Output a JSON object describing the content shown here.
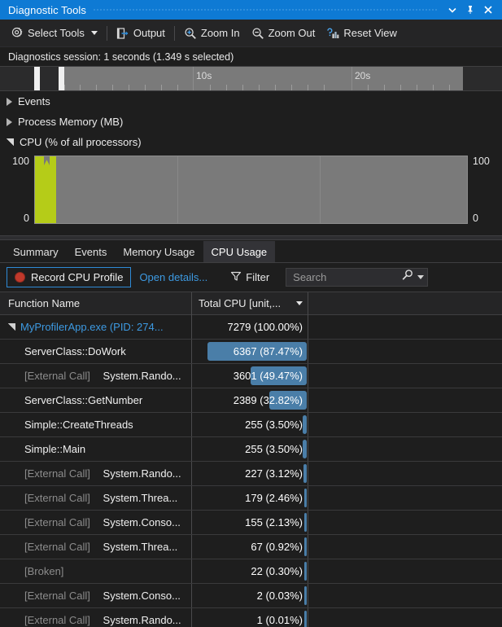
{
  "window": {
    "title": "Diagnostic Tools",
    "controls": [
      {
        "name": "window-dropdown-button",
        "icon": "chevron-down-icon"
      },
      {
        "name": "pin-button",
        "icon": "pin-icon"
      },
      {
        "name": "close-button",
        "icon": "close-icon"
      }
    ]
  },
  "toolbar": {
    "select_tools_label": "Select Tools",
    "output_label": "Output",
    "zoom_in_label": "Zoom In",
    "zoom_out_label": "Zoom Out",
    "reset_view_label": "Reset View"
  },
  "session": {
    "text": "Diagnostics session: 1 seconds (1.349 s selected)"
  },
  "ruler": {
    "labels": [
      {
        "text": "10s",
        "x": 239
      },
      {
        "text": "20s",
        "x": 434
      }
    ]
  },
  "sections": [
    {
      "label": "Events",
      "expanded": false
    },
    {
      "label": "Process Memory (MB)",
      "expanded": false
    },
    {
      "label": "CPU (% of all processors)",
      "expanded": true
    }
  ],
  "cpu_chart": {
    "axis_max": "100",
    "axis_min": "0"
  },
  "chart_data": {
    "type": "area",
    "title": "CPU (% of all processors)",
    "ylabel": "",
    "xlabel": "",
    "ylim": [
      0,
      100
    ],
    "axis_labels_left": [
      "100",
      "0"
    ],
    "axis_labels_right": [
      "100",
      "0"
    ],
    "grid": true,
    "series": [
      {
        "name": "CPU",
        "color": "#b5cc18",
        "x": [
          0.0,
          0.3,
          0.55,
          0.8,
          1.05,
          1.35
        ],
        "values": [
          100,
          100,
          82,
          100,
          100,
          0
        ]
      }
    ],
    "note": "Activity only in the first ~1.35 s of the 30 s timeline; remainder is empty."
  },
  "tabs": [
    {
      "label": "Summary",
      "active": false
    },
    {
      "label": "Events",
      "active": false
    },
    {
      "label": "Memory Usage",
      "active": false
    },
    {
      "label": "CPU Usage",
      "active": true
    }
  ],
  "actions": {
    "record_label": "Record CPU Profile",
    "open_details_label": "Open details...",
    "filter_label": "Filter",
    "search_placeholder": "Search"
  },
  "table": {
    "columns": [
      {
        "label": "Function Name"
      },
      {
        "label": "Total CPU [unit,..."
      }
    ],
    "rows": [
      {
        "name": "MyProfilerApp.exe (PID: 274...",
        "prefix": "",
        "style": "root",
        "expander": true,
        "cpu": "7279 (100.00%)",
        "pct": 100.0
      },
      {
        "name": "ServerClass::DoWork",
        "prefix": "",
        "style": "normal",
        "expander": false,
        "cpu": "6367 (87.47%)",
        "pct": 87.47
      },
      {
        "name": "System.Rando...",
        "prefix": "[External Call]",
        "style": "normal",
        "expander": false,
        "cpu": "3601 (49.47%)",
        "pct": 49.47
      },
      {
        "name": "ServerClass::GetNumber",
        "prefix": "",
        "style": "normal",
        "expander": false,
        "cpu": "2389 (32.82%)",
        "pct": 32.82
      },
      {
        "name": "Simple::CreateThreads",
        "prefix": "",
        "style": "normal",
        "expander": false,
        "cpu": "255 (3.50%)",
        "pct": 3.5
      },
      {
        "name": "Simple::Main",
        "prefix": "",
        "style": "normal",
        "expander": false,
        "cpu": "255 (3.50%)",
        "pct": 3.5
      },
      {
        "name": "System.Rando...",
        "prefix": "[External Call]",
        "style": "normal",
        "expander": false,
        "cpu": "227 (3.12%)",
        "pct": 3.12
      },
      {
        "name": "System.Threa...",
        "prefix": "[External Call]",
        "style": "normal",
        "expander": false,
        "cpu": "179 (2.46%)",
        "pct": 2.46
      },
      {
        "name": "System.Conso...",
        "prefix": "[External Call]",
        "style": "normal",
        "expander": false,
        "cpu": "155 (2.13%)",
        "pct": 2.13
      },
      {
        "name": "System.Threa...",
        "prefix": "[External Call]",
        "style": "normal",
        "expander": false,
        "cpu": "67 (0.92%)",
        "pct": 0.92
      },
      {
        "name": "[Broken]",
        "prefix": "",
        "style": "broken",
        "expander": false,
        "cpu": "22 (0.30%)",
        "pct": 0.3
      },
      {
        "name": "System.Conso...",
        "prefix": "[External Call]",
        "style": "normal",
        "expander": false,
        "cpu": "2 (0.03%)",
        "pct": 0.03
      },
      {
        "name": "System.Rando...",
        "prefix": "[External Call]",
        "style": "normal",
        "expander": false,
        "cpu": "1 (0.01%)",
        "pct": 0.01
      }
    ]
  },
  "colors": {
    "title_bar": "#0e7ad4",
    "accent_link": "#3d9ae2",
    "cpu_area": "#b5cc18",
    "data_bar": "#4a7ea8",
    "record_dot": "#c0392b"
  }
}
